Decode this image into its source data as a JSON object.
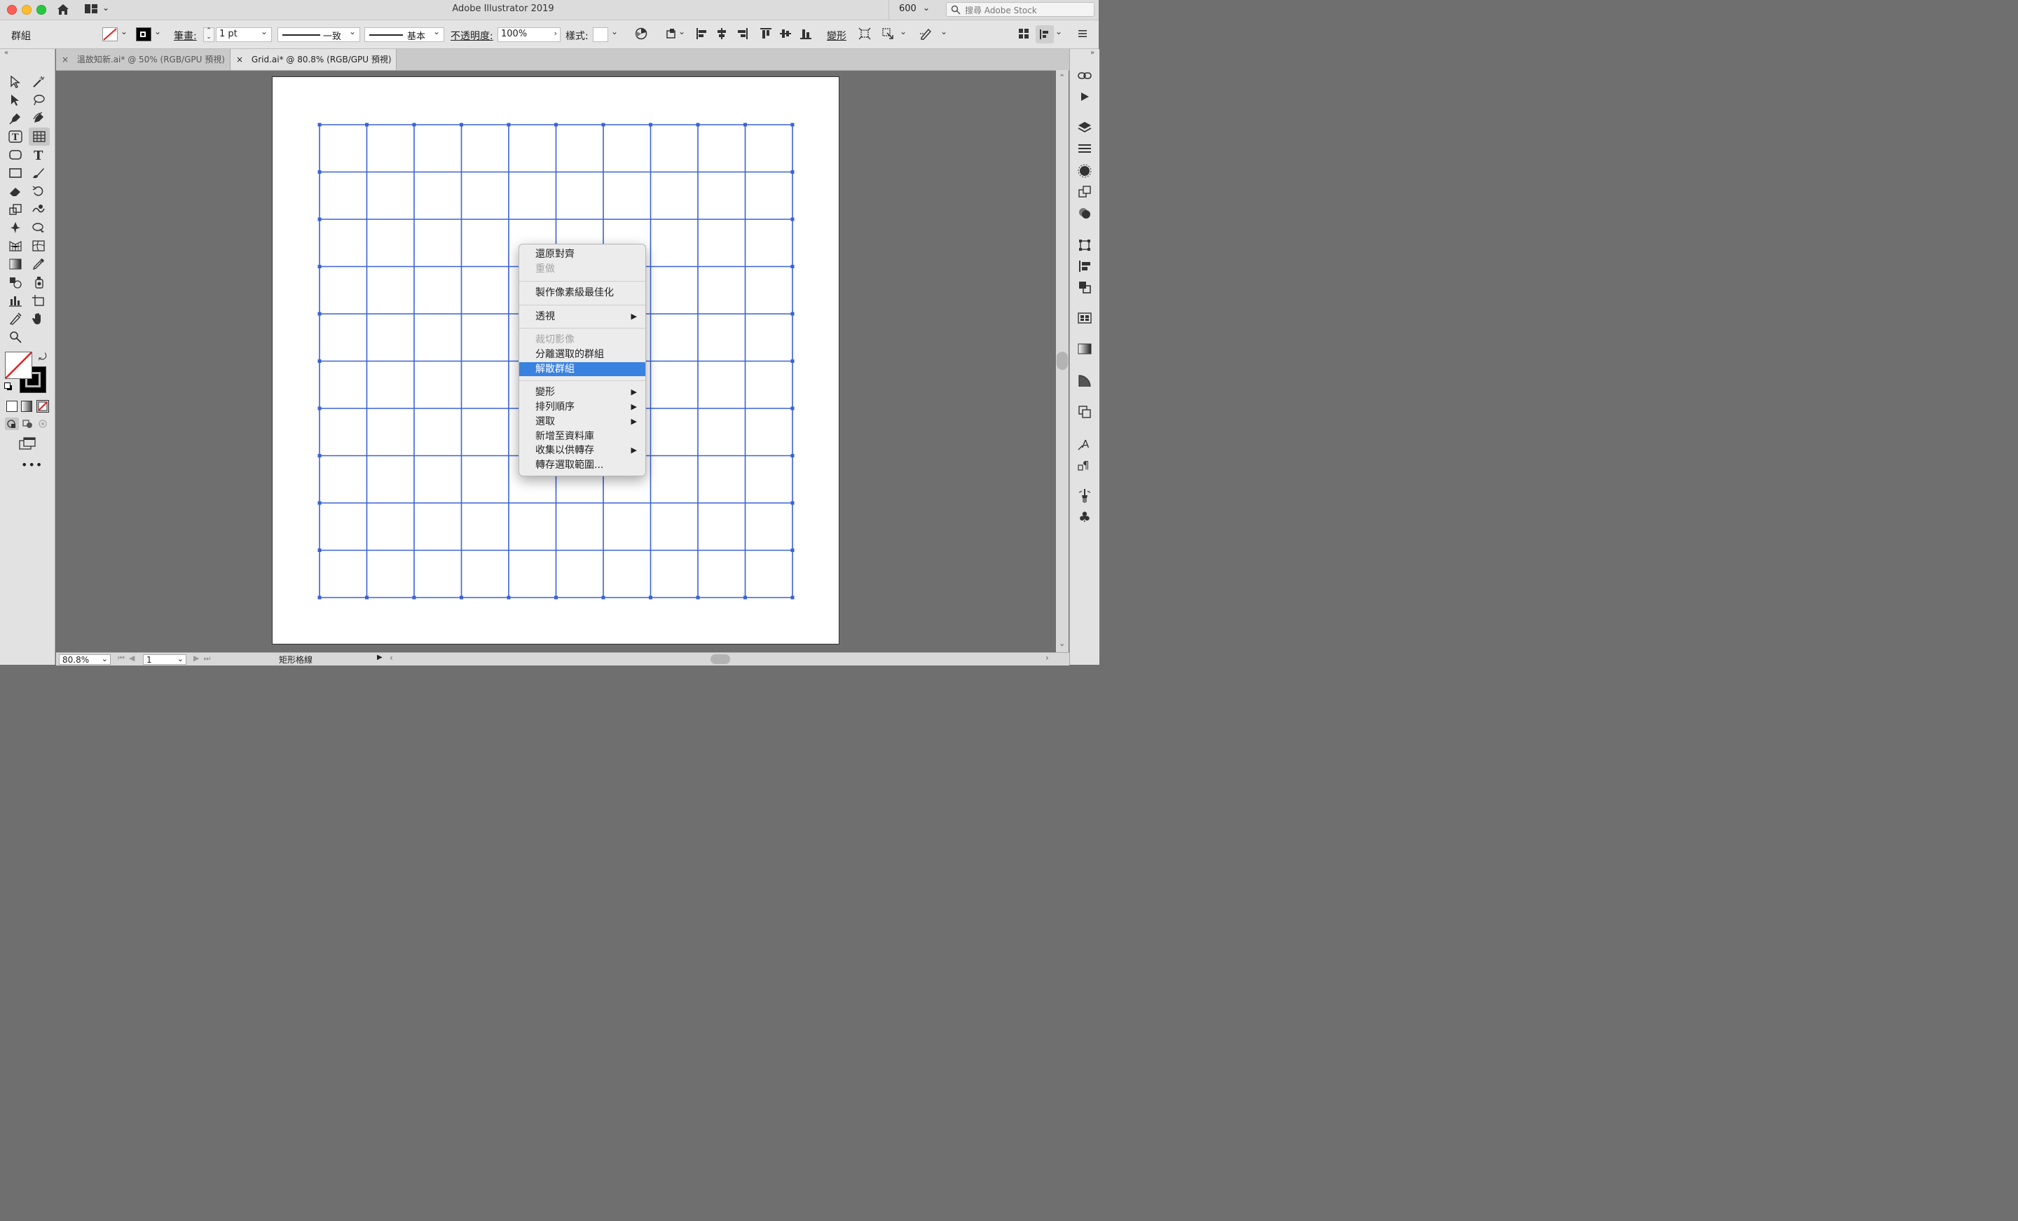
{
  "window": {
    "title": "Adobe Illustrator 2019"
  },
  "titlebar": {
    "workspace_value": "600",
    "search_placeholder": "搜尋 Adobe Stock"
  },
  "controlbar": {
    "selection_label": "群組",
    "stroke_label": "筆畫:",
    "stroke_value": "1 pt",
    "profile_label": "一致",
    "brush_label": "基本",
    "opacity_label": "不透明度:",
    "opacity_value": "100%",
    "style_label": "樣式:",
    "transform_label": "變形"
  },
  "tabs": [
    {
      "label": "溫故知新.ai* @ 50% (RGB/GPU 預視)"
    },
    {
      "label": "Grid.ai* @ 80.8% (RGB/GPU 預視)"
    }
  ],
  "statusbar": {
    "zoom": "80.8%",
    "artboard_number": "1",
    "tool_name": "矩形格線"
  },
  "grid": {
    "rows": 10,
    "cols": 10,
    "stroke_color": "#3a62d6"
  },
  "context_menu": {
    "items": [
      {
        "label": "還原對齊",
        "disabled": false,
        "submenu": false,
        "highlighted": false
      },
      {
        "label": "重做",
        "disabled": true,
        "submenu": false,
        "highlighted": false
      },
      {
        "label": "製作像素級最佳化",
        "disabled": false,
        "submenu": false,
        "highlighted": false
      },
      {
        "label": "透視",
        "disabled": false,
        "submenu": true,
        "highlighted": false
      },
      {
        "label": "裁切影像",
        "disabled": true,
        "submenu": false,
        "highlighted": false
      },
      {
        "label": "分離選取的群組",
        "disabled": false,
        "submenu": false,
        "highlighted": false
      },
      {
        "label": "解散群組",
        "disabled": false,
        "submenu": false,
        "highlighted": true
      },
      {
        "label": "變形",
        "disabled": false,
        "submenu": true,
        "highlighted": false
      },
      {
        "label": "排列順序",
        "disabled": false,
        "submenu": true,
        "highlighted": false
      },
      {
        "label": "選取",
        "disabled": false,
        "submenu": true,
        "highlighted": false
      },
      {
        "label": "新增至資料庫",
        "disabled": false,
        "submenu": false,
        "highlighted": false
      },
      {
        "label": "收集以供轉存",
        "disabled": false,
        "submenu": true,
        "highlighted": false
      },
      {
        "label": "轉存選取範圍...",
        "disabled": false,
        "submenu": false,
        "highlighted": false
      }
    ],
    "submenu_arrow": "▶",
    "highlight_color": "#3a82e0"
  },
  "icons": {
    "tab_close": "×",
    "chevron": "⌄"
  }
}
